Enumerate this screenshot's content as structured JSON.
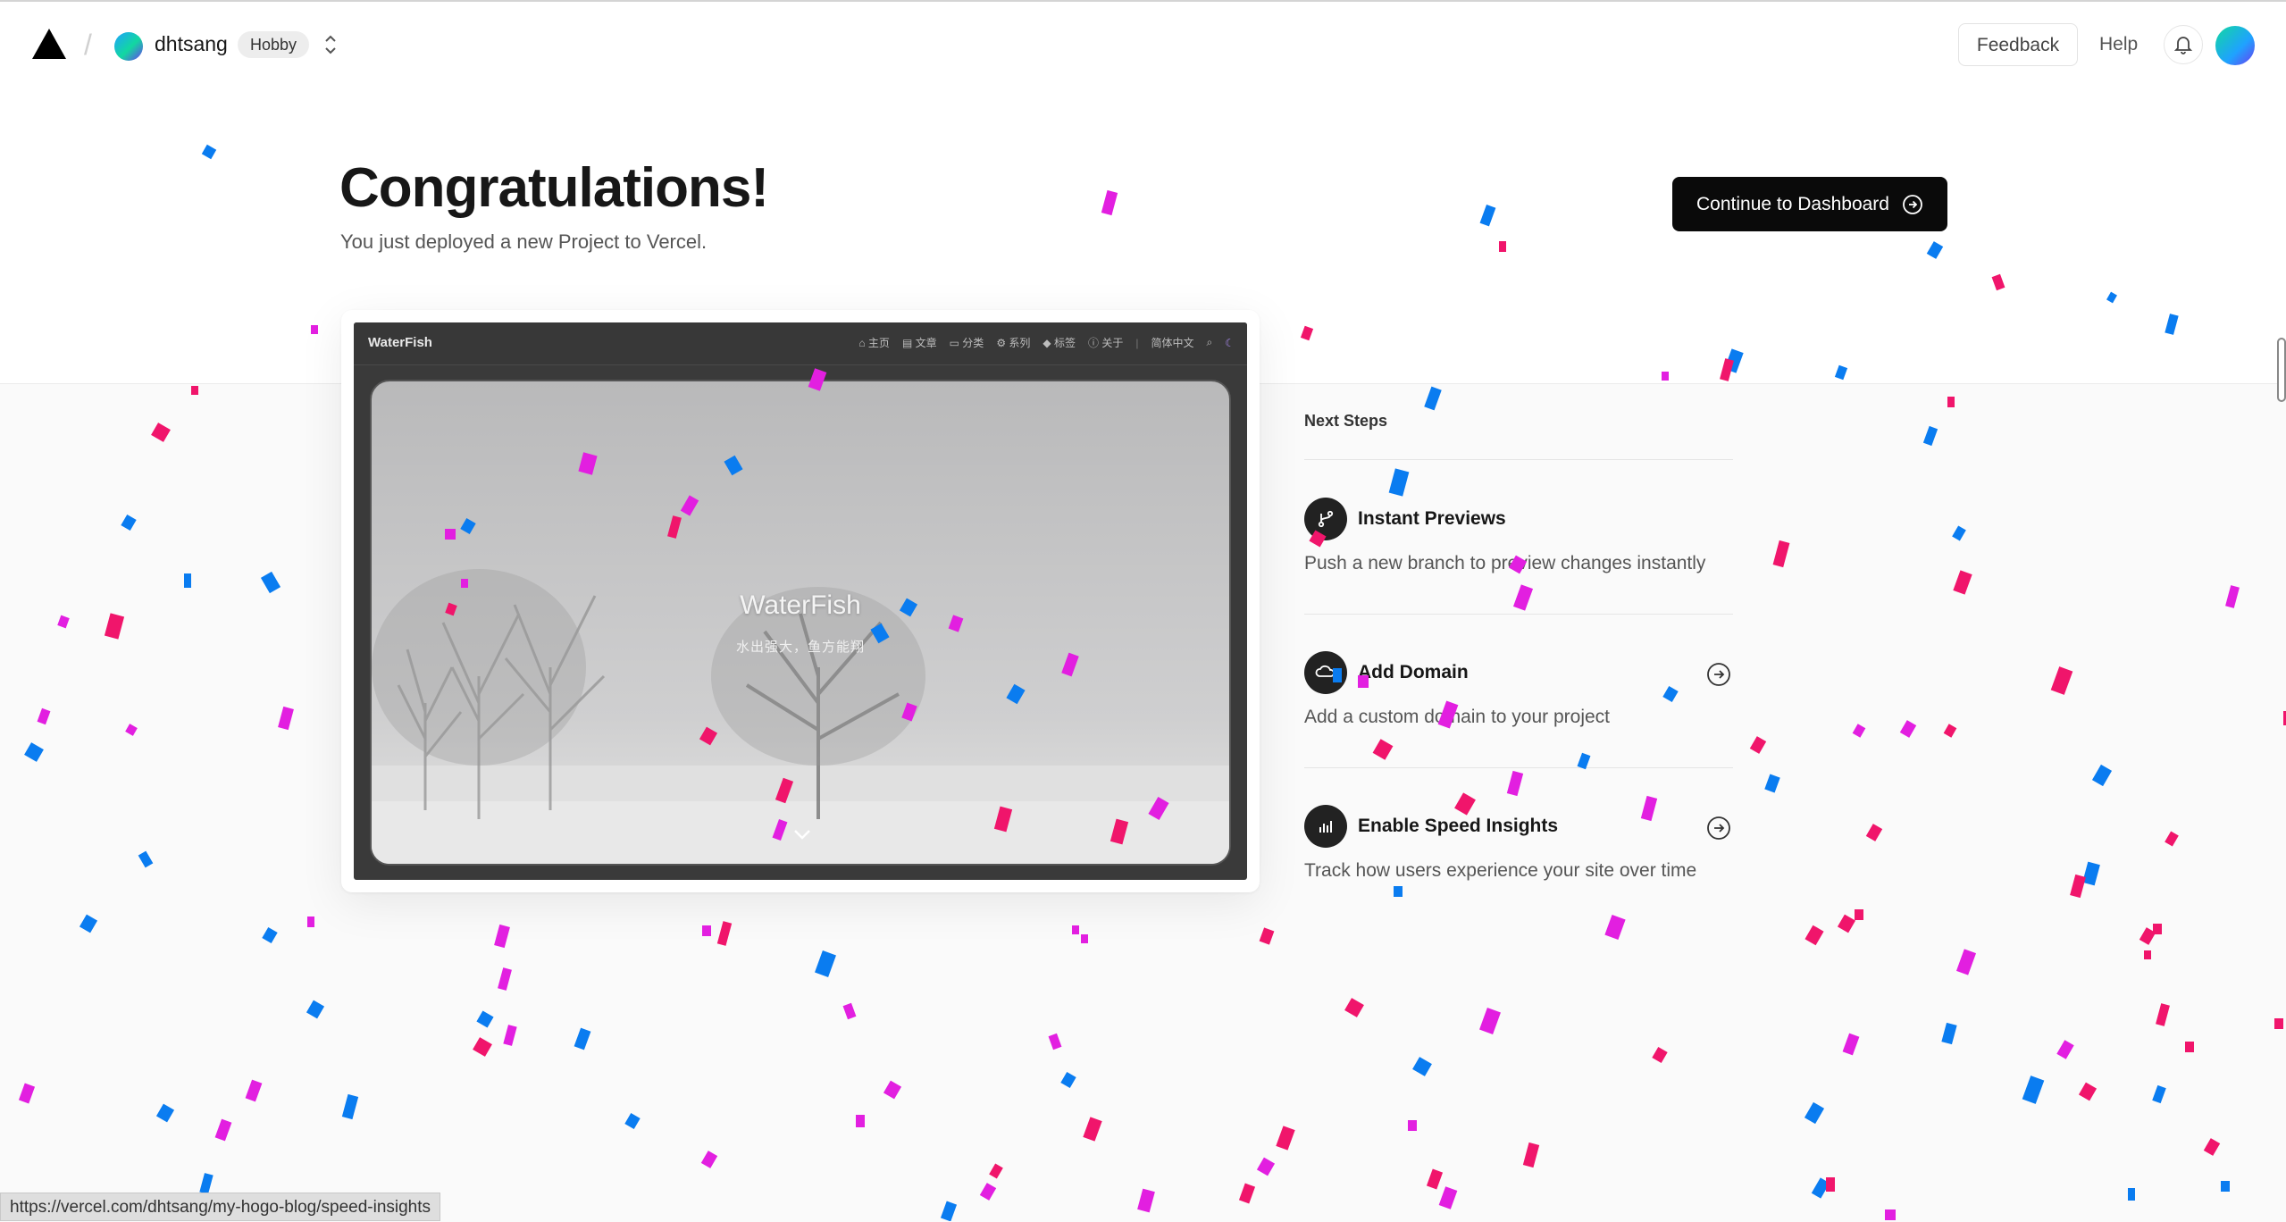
{
  "header": {
    "team_name": "dhtsang",
    "plan_badge": "Hobby",
    "feedback_label": "Feedback",
    "help_label": "Help"
  },
  "hero": {
    "title": "Congratulations!",
    "subtitle": "You just deployed a new Project to Vercel.",
    "continue_label": "Continue to Dashboard"
  },
  "preview": {
    "site_brand": "WaterFish",
    "menu": [
      "主页",
      "文章",
      "分类",
      "系列",
      "标签",
      "关于"
    ],
    "language": "简体中文",
    "hero_title": "WaterFish",
    "hero_subtitle": "水出强大，鱼方能翔"
  },
  "next_steps": {
    "heading": "Next Steps",
    "items": [
      {
        "title": "Instant Previews",
        "desc": "Push a new branch to preview changes instantly",
        "icon": "git-branch-icon"
      },
      {
        "title": "Add Domain",
        "desc": "Add a custom domain to your project",
        "icon": "globe-icon"
      },
      {
        "title": "Enable Speed Insights",
        "desc": "Track how users experience your site over time",
        "icon": "bar-chart-icon"
      }
    ]
  },
  "status_bar": {
    "url": "https://vercel.com/dhtsang/my-hogo-blog/speed-insights"
  },
  "colors": {
    "accent_dark": "#0a0a0a",
    "confetti_blue": "#0a7cf0",
    "confetti_pink": "#f0156b",
    "confetti_magenta": "#e21fe0"
  }
}
